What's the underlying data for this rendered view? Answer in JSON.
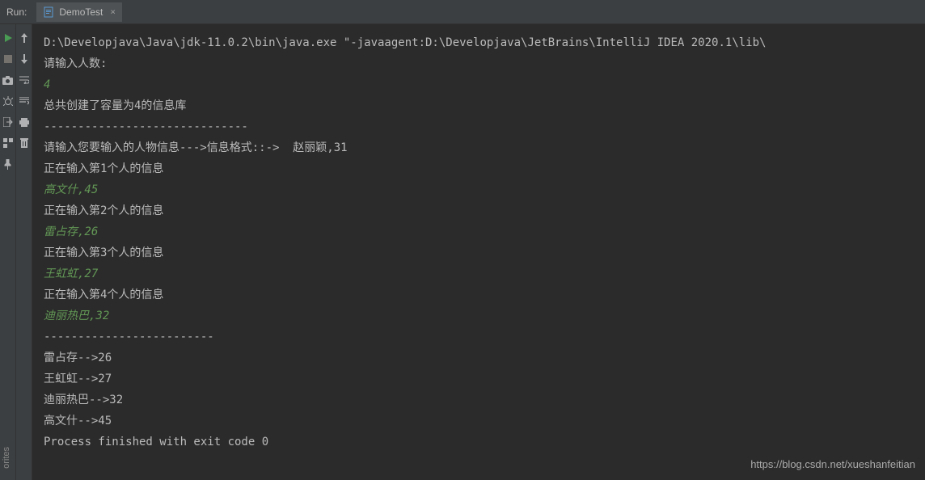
{
  "header": {
    "run_label": "Run:",
    "tab_label": "DemoTest"
  },
  "console": {
    "lines": [
      {
        "type": "output",
        "text": "D:\\Developjava\\Java\\jdk-11.0.2\\bin\\java.exe \"-javaagent:D:\\Developjava\\JetBrains\\IntelliJ IDEA 2020.1\\lib\\"
      },
      {
        "type": "output",
        "text": "请输入人数:"
      },
      {
        "type": "input",
        "text": "4"
      },
      {
        "type": "output",
        "text": "总共创建了容量为4的信息库"
      },
      {
        "type": "output",
        "text": "------------------------------"
      },
      {
        "type": "output",
        "text": "请输入您要输入的人物信息--->信息格式::->  赵丽颖,31"
      },
      {
        "type": "output",
        "text": "正在输入第1个人的信息"
      },
      {
        "type": "input",
        "text": "高文什,45"
      },
      {
        "type": "output",
        "text": "正在输入第2个人的信息"
      },
      {
        "type": "input",
        "text": "雷占存,26"
      },
      {
        "type": "output",
        "text": "正在输入第3个人的信息"
      },
      {
        "type": "input",
        "text": "王虹虹,27"
      },
      {
        "type": "output",
        "text": "正在输入第4个人的信息"
      },
      {
        "type": "input",
        "text": "迪丽热巴,32"
      },
      {
        "type": "output",
        "text": "-------------------------"
      },
      {
        "type": "output",
        "text": "雷占存-->26"
      },
      {
        "type": "output",
        "text": "王虹虹-->27"
      },
      {
        "type": "output",
        "text": "迪丽热巴-->32"
      },
      {
        "type": "output",
        "text": "高文什-->45"
      },
      {
        "type": "output",
        "text": ""
      },
      {
        "type": "output",
        "text": "Process finished with exit code 0"
      }
    ]
  },
  "watermark": "https://blog.csdn.net/xueshanfeitian",
  "sidebar_label": "orites"
}
